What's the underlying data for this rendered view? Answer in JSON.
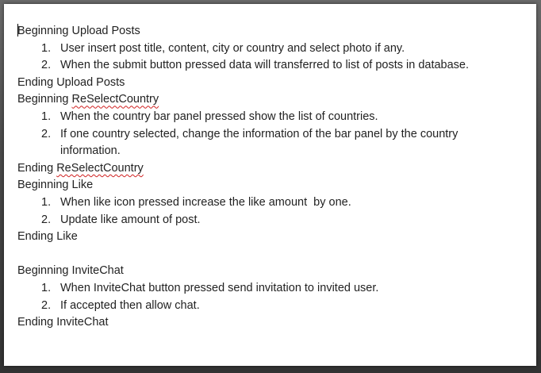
{
  "document": {
    "sections": [
      {
        "begin_prefix": "Beginning ",
        "name": "Upload Posts",
        "end_prefix": "Ending ",
        "steps": [
          {
            "number": "1.",
            "text": "User insert post title, content, city or country and select photo if any."
          },
          {
            "number": "2.",
            "text": "When the submit button pressed data will transferred to list of posts in database."
          }
        ]
      },
      {
        "begin_prefix": "Beginning ",
        "name": "ReSelectCountry",
        "end_prefix": "Ending ",
        "steps": [
          {
            "number": "1.",
            "text": "When the country bar panel pressed show the list of countries."
          },
          {
            "number": "2.",
            "text": "If one country selected, change the information of the bar panel by the country information."
          }
        ]
      },
      {
        "begin_prefix": "Beginning ",
        "name": "Like",
        "end_prefix": "Ending ",
        "steps": [
          {
            "number": "1.",
            "text": "When like icon pressed increase the like amount  by one."
          },
          {
            "number": "2.",
            "text": "Update like amount of post."
          }
        ]
      },
      {
        "begin_prefix": "Beginning ",
        "name": "InviteChat",
        "end_prefix": "Ending ",
        "steps": [
          {
            "number": "1.",
            "text": "When InviteChat button pressed send invitation to invited user."
          },
          {
            "number": "2.",
            "text": "If accepted then allow chat."
          }
        ]
      }
    ]
  }
}
